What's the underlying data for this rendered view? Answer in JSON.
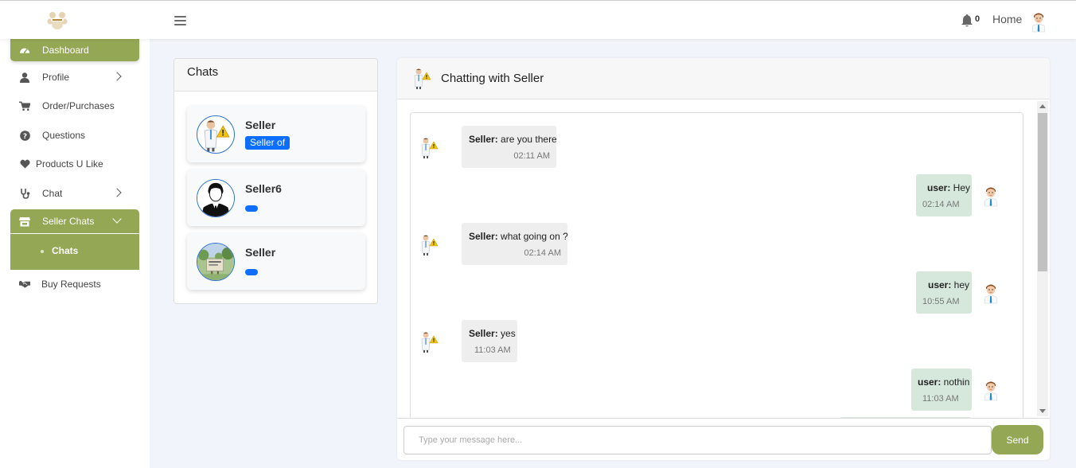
{
  "topbar": {
    "notification_count": "0",
    "home_label": "Home"
  },
  "sidebar": {
    "items": [
      {
        "label": "Dashboard",
        "icon": "dashboard-icon"
      },
      {
        "label": "Profile",
        "icon": "user-icon"
      },
      {
        "label": "Order/Purchases",
        "icon": "cart-icon"
      },
      {
        "label": "Questions",
        "icon": "question-icon"
      },
      {
        "label": "Products U Like",
        "icon": "heart-icon"
      },
      {
        "label": "Chat",
        "icon": "stethoscope-icon"
      },
      {
        "label": "Seller Chats",
        "icon": "store-icon"
      },
      {
        "label": "Buy Requests",
        "icon": "handshake-icon"
      }
    ],
    "sub_items": [
      {
        "label": "Chats"
      }
    ]
  },
  "chats": {
    "title": "Chats",
    "contacts": [
      {
        "name": "Seller",
        "badge": "Seller of"
      },
      {
        "name": "Seller6",
        "badge": ""
      },
      {
        "name": "Seller",
        "badge": ""
      }
    ]
  },
  "conversation": {
    "title": "Chatting with Seller",
    "messages": [
      {
        "sender": "Seller:",
        "text": " are you there",
        "time": "02:11 AM",
        "mine": false
      },
      {
        "sender": "user:",
        "text": " Hey",
        "time": "02:14 AM",
        "mine": true
      },
      {
        "sender": "Seller:",
        "text": " what going on ?",
        "time": "02:14 AM",
        "mine": false
      },
      {
        "sender": "user:",
        "text": " hey",
        "time": "10:55 AM",
        "mine": true
      },
      {
        "sender": "Seller:",
        "text": " yes",
        "time": "11:03 AM",
        "mine": false
      },
      {
        "sender": "user:",
        "text": " nothin",
        "time": "11:03 AM",
        "mine": true
      }
    ],
    "input_placeholder": "Type your message here...",
    "send_label": "Send"
  },
  "colors": {
    "accent": "#93a755",
    "badge": "#0d6efd",
    "my_bubble": "#d6e8dc",
    "their_bubble": "#eeeeee"
  }
}
